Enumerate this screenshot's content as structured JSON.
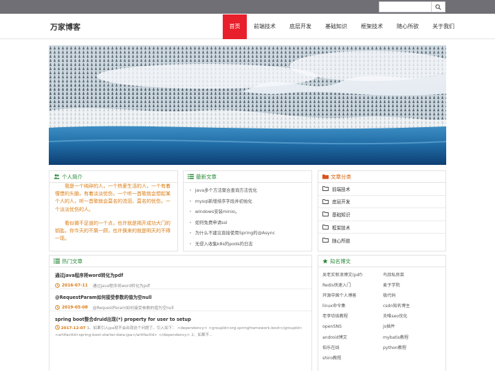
{
  "search": {
    "placeholder": ""
  },
  "site": {
    "title": "万家博客"
  },
  "nav": [
    {
      "label": "首页",
      "active": true
    },
    {
      "label": "前端技术"
    },
    {
      "label": "底层开发"
    },
    {
      "label": "基础知识"
    },
    {
      "label": "框架技术"
    },
    {
      "label": "随心所欲"
    },
    {
      "label": "关于我们"
    }
  ],
  "intro": {
    "title": "个人简介",
    "p1": "我是一个纯碎的人，一个热爱生活的人，一个有着憧憬的头脑，有着淡淡忧伤，一个听一首歌就会想起某个人的人，听一首歌就会莫名的流泪，莫名的忧伤，一个淡淡忧伤的人。",
    "p2": "看似微不足道的一个点，也许就是揭开成功大门的钥匙，你今天的不屑一顾，也许换来的就是明天的不得一现。"
  },
  "latest": {
    "title": "最新文章",
    "items": [
      "java多个方法聚合查询方法优化",
      "mysql新增排序字段并初始化",
      "windows安装minio。",
      "如何免费申请ssl",
      "为什么不建议直接使用Spring的@Async",
      "无侵入收集k8s的pods的日志"
    ]
  },
  "categories": {
    "title": "文章分类",
    "items": [
      "前端技术",
      "底层开发",
      "基础知识",
      "框架技术",
      "随心所欲"
    ]
  },
  "hot": {
    "title": "热门文章",
    "items": [
      {
        "title": "通过java程序将word转化为pdf",
        "date": "2016-07-11",
        "summary": "通过java程序将word转化为pdf"
      },
      {
        "title": "@RequestParam如何接受参数的值为空null",
        "date": "2019-05-08",
        "summary": "@RequestParam如何接受参数的值为空null"
      },
      {
        "title": "spring boot整合druid出现(*) property for user to setup",
        "date": "2017-12-07",
        "summary": "1、如果引入jpa就不会出现这个问题了。引入如下：   <dependency> <groupId>org.springframework.boot</groupId> <artifactId>spring-boot-starter-data-jpa</artifactId> </dependency> 2、如果不..."
      }
    ]
  },
  "blogs": {
    "title": "知名博文",
    "items": [
      "吴老实新浪博文(pdf)",
      "鸟叔私房菜",
      "Redis快速入门",
      "麦子学院",
      "开源中国个人博客",
      "极代码",
      "linux命令集",
      "csdn知名博主",
      "老李坊结教程",
      "夫唯seo优化",
      "openSNS",
      "js插件",
      "android博文",
      "mybatis教程",
      "伯乐在线",
      "python教程",
      "shiro教程"
    ]
  },
  "colors": {
    "accent": "#e8202b",
    "topbar": "#6f6f75",
    "green": "#2c8a3a",
    "orange": "#d97a10"
  }
}
